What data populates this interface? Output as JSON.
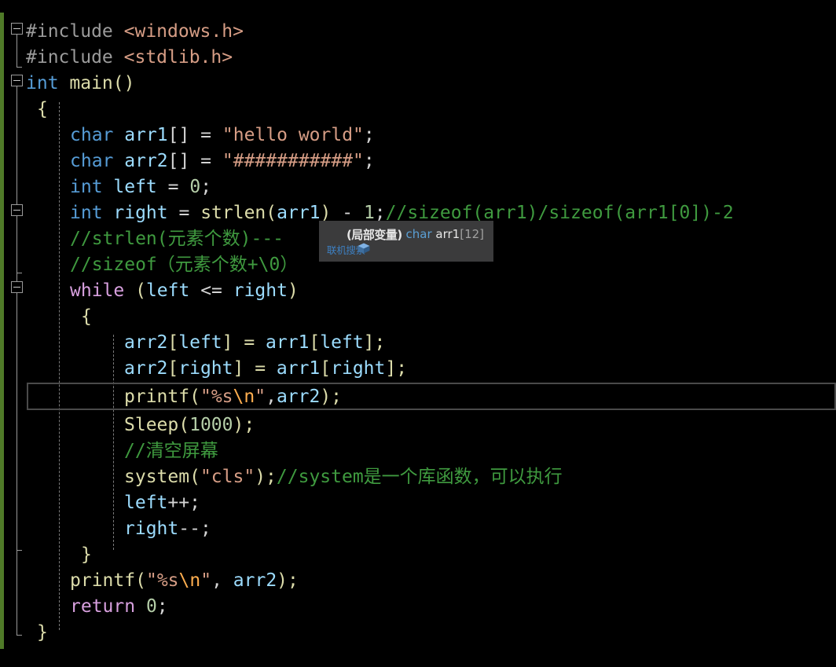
{
  "editor": {
    "background": "#000000",
    "change_bar_color": "#4f7a28",
    "font_size_px": 23,
    "line_height_px": 33
  },
  "code_lines": [
    {
      "indent": 0,
      "text": "#include <windows.h>"
    },
    {
      "indent": 0,
      "text": "#include <stdlib.h>"
    },
    {
      "indent": 0,
      "text": "int main()"
    },
    {
      "indent": 1,
      "text": "{"
    },
    {
      "indent": 2,
      "text": "char arr1[] = \"hello world\";"
    },
    {
      "indent": 2,
      "text": "char arr2[] = \"###########\";"
    },
    {
      "indent": 2,
      "text": "int left = 0;"
    },
    {
      "indent": 2,
      "text": "int right = strlen(arr1) - 1;//sizeof(arr1)/sizeof(arr1[0])-2"
    },
    {
      "indent": 2,
      "text": "//strlen(元素个数)---"
    },
    {
      "indent": 2,
      "text": "//sizeof（元素个数+\\0）"
    },
    {
      "indent": 2,
      "text": "while (left <= right)"
    },
    {
      "indent": 2,
      "text": "{"
    },
    {
      "indent": 3,
      "text": "arr2[left] = arr1[left];"
    },
    {
      "indent": 3,
      "text": "arr2[right] = arr1[right];"
    },
    {
      "indent": 3,
      "text": "printf(\"%s\\n\",arr2);"
    },
    {
      "indent": 3,
      "text": "Sleep(1000);"
    },
    {
      "indent": 3,
      "text": "//清空屏幕"
    },
    {
      "indent": 3,
      "text": "system(\"cls\");//system是一个库函数，可以执行"
    },
    {
      "indent": 3,
      "text": "left++;"
    },
    {
      "indent": 3,
      "text": "right--;"
    },
    {
      "indent": 2,
      "text": "}"
    },
    {
      "indent": 2,
      "text": "printf(\"%s\\n\", arr2);"
    },
    {
      "indent": 2,
      "text": "return 0;"
    },
    {
      "indent": 1,
      "text": "}"
    }
  ],
  "tokens": {
    "l1_pp": "#include ",
    "l1_file": "<windows.h>",
    "l2_pp": "#include ",
    "l2_file": "<stdlib.h>",
    "l3_kw": "int ",
    "l3_fn": "main",
    "l3_par": "()",
    "l4_brace": "{",
    "l5_kw": "char ",
    "l5_id": "arr1",
    "l5_op": "[] = ",
    "l5_str": "\"hello world\"",
    "l5_semi": ";",
    "l6_kw": "char ",
    "l6_id": "arr2",
    "l6_op": "[] = ",
    "l6_str": "\"###########\"",
    "l6_semi": ";",
    "l7_kw": "int ",
    "l7_id": "left",
    "l7_op": " = ",
    "l7_num": "0",
    "l7_semi": ";",
    "l8_kw": "int ",
    "l8_id": "right",
    "l8_op": " = ",
    "l8_fn": "strlen",
    "l8_p1": "(",
    "l8_arg": "arr1",
    "l8_p2": ")",
    "l8_minus": " - ",
    "l8_num": "1",
    "l8_semi": ";",
    "l8_cmt": "//sizeof(arr1)/sizeof(arr1[0])-2",
    "l9_cmt": "//strlen(元素个数)---",
    "l10_cmt": "//sizeof（元素个数+\\0）",
    "l11_ctl": "while ",
    "l11_p1": "(",
    "l11_id1": "left",
    "l11_op": " <= ",
    "l11_id2": "right",
    "l11_p2": ")",
    "l12_brace": "{",
    "l13_a": "arr2",
    "l13_b": "[",
    "l13_c": "left",
    "l13_d": "] = ",
    "l13_e": "arr1",
    "l13_f": "[",
    "l13_g": "left",
    "l13_h": "];",
    "l14_a": "arr2",
    "l14_b": "[",
    "l14_c": "right",
    "l14_d": "] = ",
    "l14_e": "arr1",
    "l14_f": "[",
    "l14_g": "right",
    "l14_h": "];",
    "l15_fn": "printf",
    "l15_p1": "(",
    "l15_q1": "\"",
    "l15_pct": "%s",
    "l15_esc": "\\n",
    "l15_q2": "\"",
    "l15_comma": ",",
    "l15_arg": "arr2",
    "l15_p2": ");",
    "l16_fn": "Sleep",
    "l16_p1": "(",
    "l16_num": "1000",
    "l16_p2": ");",
    "l17_cmt": "//清空屏幕",
    "l18_fn": "system",
    "l18_p1": "(",
    "l18_str": "\"cls\"",
    "l18_p2": ");",
    "l18_cmt": "//system是一个库函数，可以执行",
    "l19_id": "left",
    "l19_op": "++;",
    "l20_id": "right",
    "l20_op": "--;",
    "l21_brace": "}",
    "l22_fn": "printf",
    "l22_p1": "(",
    "l22_q1": "\"",
    "l22_pct": "%s",
    "l22_esc": "\\n",
    "l22_q2": "\"",
    "l22_comma": ", ",
    "l22_arg": "arr2",
    "l22_p2": ");",
    "l23_ctl": "return ",
    "l23_num": "0",
    "l23_semi": ";",
    "l24_brace": "}"
  },
  "tooltip": {
    "icon": "field-box-icon",
    "kind": "(局部变量)",
    "type": "char",
    "name": "arr1",
    "dimension": "[12]",
    "link": "联机搜索",
    "background": "#3b3b3c",
    "link_color": "#3d7fc1",
    "type_color": "#5a9fd4"
  },
  "fold_markers": {
    "count": 3,
    "glyph": "minus-box",
    "state": "expanded"
  },
  "highlight_box": {
    "target_line": "printf(\"%s\\n\",arr2);",
    "border_color": "#4a4a4a"
  }
}
